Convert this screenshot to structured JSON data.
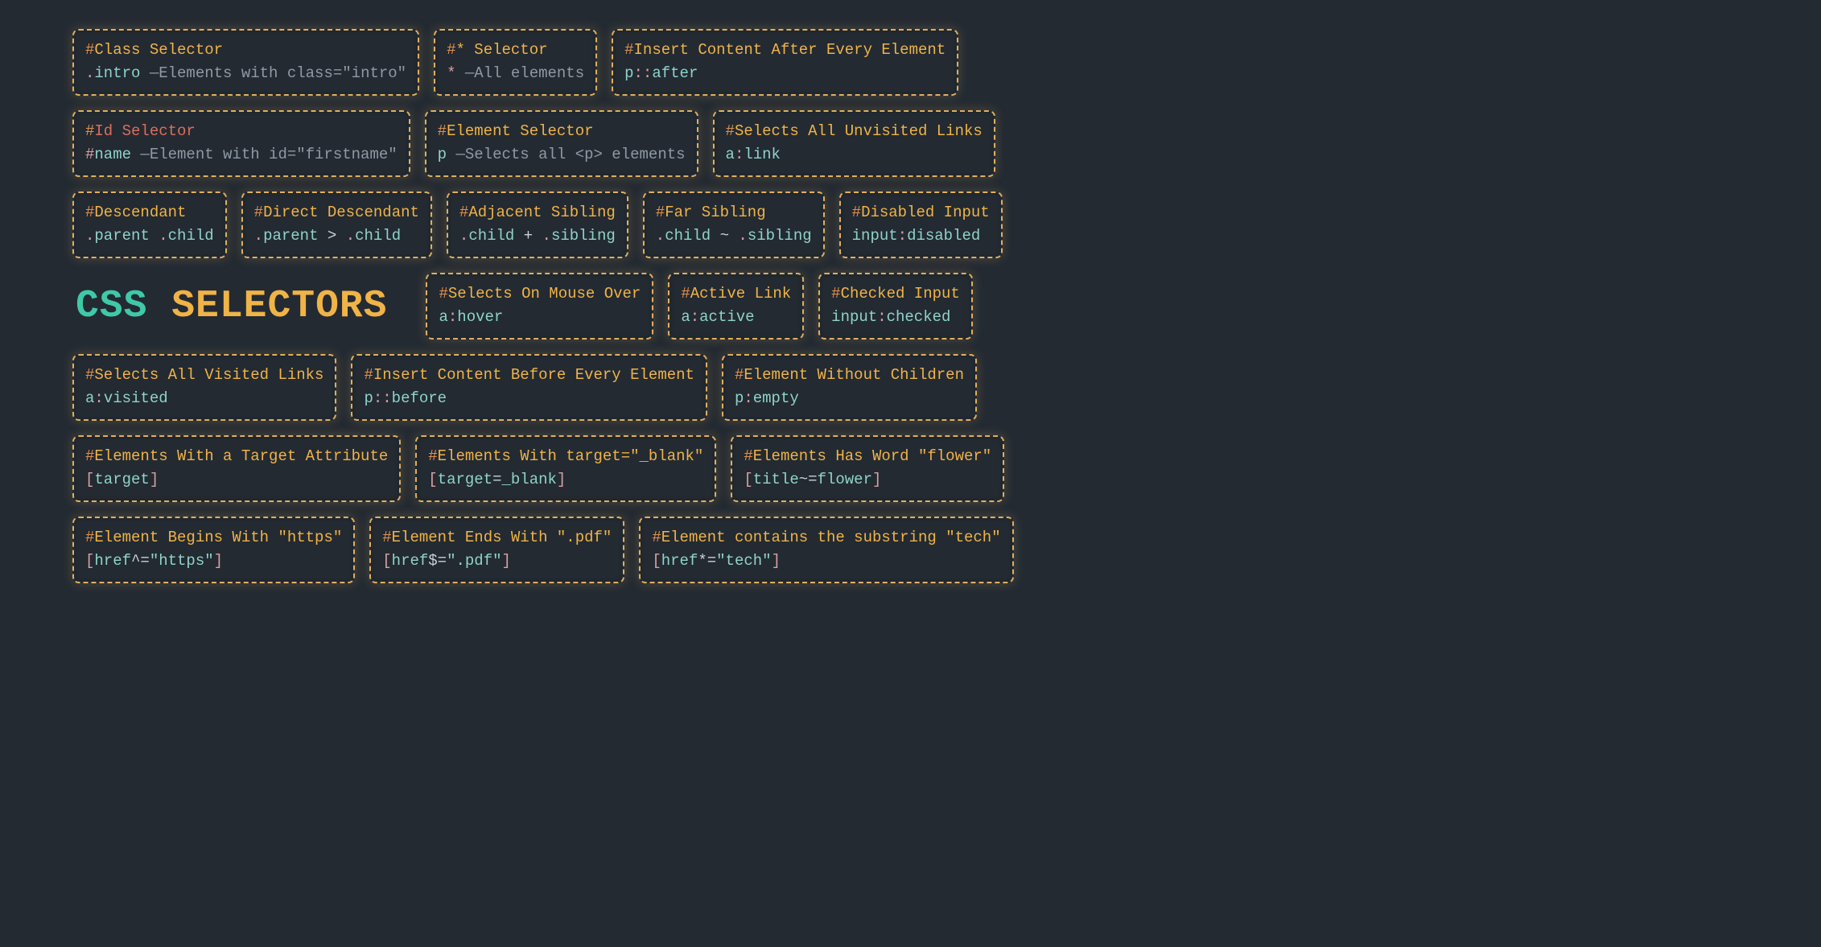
{
  "heading": {
    "css": "CSS",
    "selectors": "SELECTORS"
  },
  "cards": {
    "class": {
      "title": "Class Selector",
      "sym": ".",
      "kw": "intro",
      "dim": " —Elements with class=\"intro\""
    },
    "star": {
      "title": "* Selector",
      "sym": "*",
      "dim": "  —All elements"
    },
    "after": {
      "title": "Insert Content After Every Element",
      "kw1": "p",
      "sym": "::",
      "kw2": "after"
    },
    "id": {
      "title": "Id Selector",
      "sym": "#",
      "kw": "name",
      "dim": "  —Element with id=\"firstname\""
    },
    "element": {
      "title": "Element Selector",
      "kw": "p",
      "dim": "  —Selects all <p> elements"
    },
    "link": {
      "title": "Selects All Unvisited Links",
      "kw1": "a",
      "sym": ":",
      "kw2": "link"
    },
    "descendant": {
      "title": "Descendant",
      "s1": ".",
      "k1": "parent",
      "gap": " ",
      "s2": ".",
      "k2": "child"
    },
    "direct": {
      "title": "Direct Descendant",
      "s1": ".",
      "k1": "parent",
      "op": " > ",
      "s2": ".",
      "k2": "child"
    },
    "adjacent": {
      "title": "Adjacent Sibling",
      "s1": ".",
      "k1": "child",
      "op": " + ",
      "s2": ".",
      "k2": "sibling"
    },
    "far": {
      "title": "Far Sibling",
      "s1": ".",
      "k1": "child",
      "op": " ~ ",
      "s2": ".",
      "k2": "sibling"
    },
    "disabled": {
      "title": "Disabled Input",
      "kw1": "input",
      "sym": ":",
      "kw2": "disabled"
    },
    "hover": {
      "title": "Selects On Mouse Over",
      "kw1": "a",
      "sym": ":",
      "kw2": "hover"
    },
    "active": {
      "title": "Active Link",
      "kw1": "a",
      "sym": ":",
      "kw2": "active"
    },
    "checked": {
      "title": "Checked Input",
      "kw1": "input",
      "sym": ":",
      "kw2": "checked"
    },
    "visited": {
      "title": "Selects All Visited Links",
      "kw1": "a",
      "sym": ":",
      "kw2": "visited"
    },
    "before": {
      "title": "Insert Content Before Every Element",
      "kw1": "p",
      "sym": "::",
      "kw2": "before"
    },
    "empty": {
      "title": "Element Without Children",
      "kw1": "p",
      "sym": ":",
      "kw2": "empty"
    },
    "attrTarget": {
      "title": "Elements With a Target Attribute",
      "open": "[",
      "kw": "target",
      "close": "]"
    },
    "attrBlank": {
      "title": "Elements With target=\"_blank\"",
      "open": "[",
      "k1": "target",
      "op": "=",
      "k2": "_blank",
      "close": "]"
    },
    "attrFlower": {
      "title": "Elements Has Word \"flower\"",
      "open": "[",
      "k1": "title",
      "op": "~=",
      "k2": "flower",
      "close": "]"
    },
    "attrHttps": {
      "title": "Element Begins With \"https\"",
      "open": "[",
      "k1": "href",
      "op": "^=",
      "k2": "\"https\"",
      "close": "]"
    },
    "attrPdf": {
      "title": "Element Ends With \".pdf\"",
      "open": "[",
      "k1": "href",
      "op": "$=",
      "k2": "\".pdf\"",
      "close": "]"
    },
    "attrTech": {
      "title": "Element contains the substring \"tech\"",
      "open": "[",
      "k1": "href",
      "op": "*=",
      "k2": "\"tech\"",
      "close": "]"
    }
  }
}
